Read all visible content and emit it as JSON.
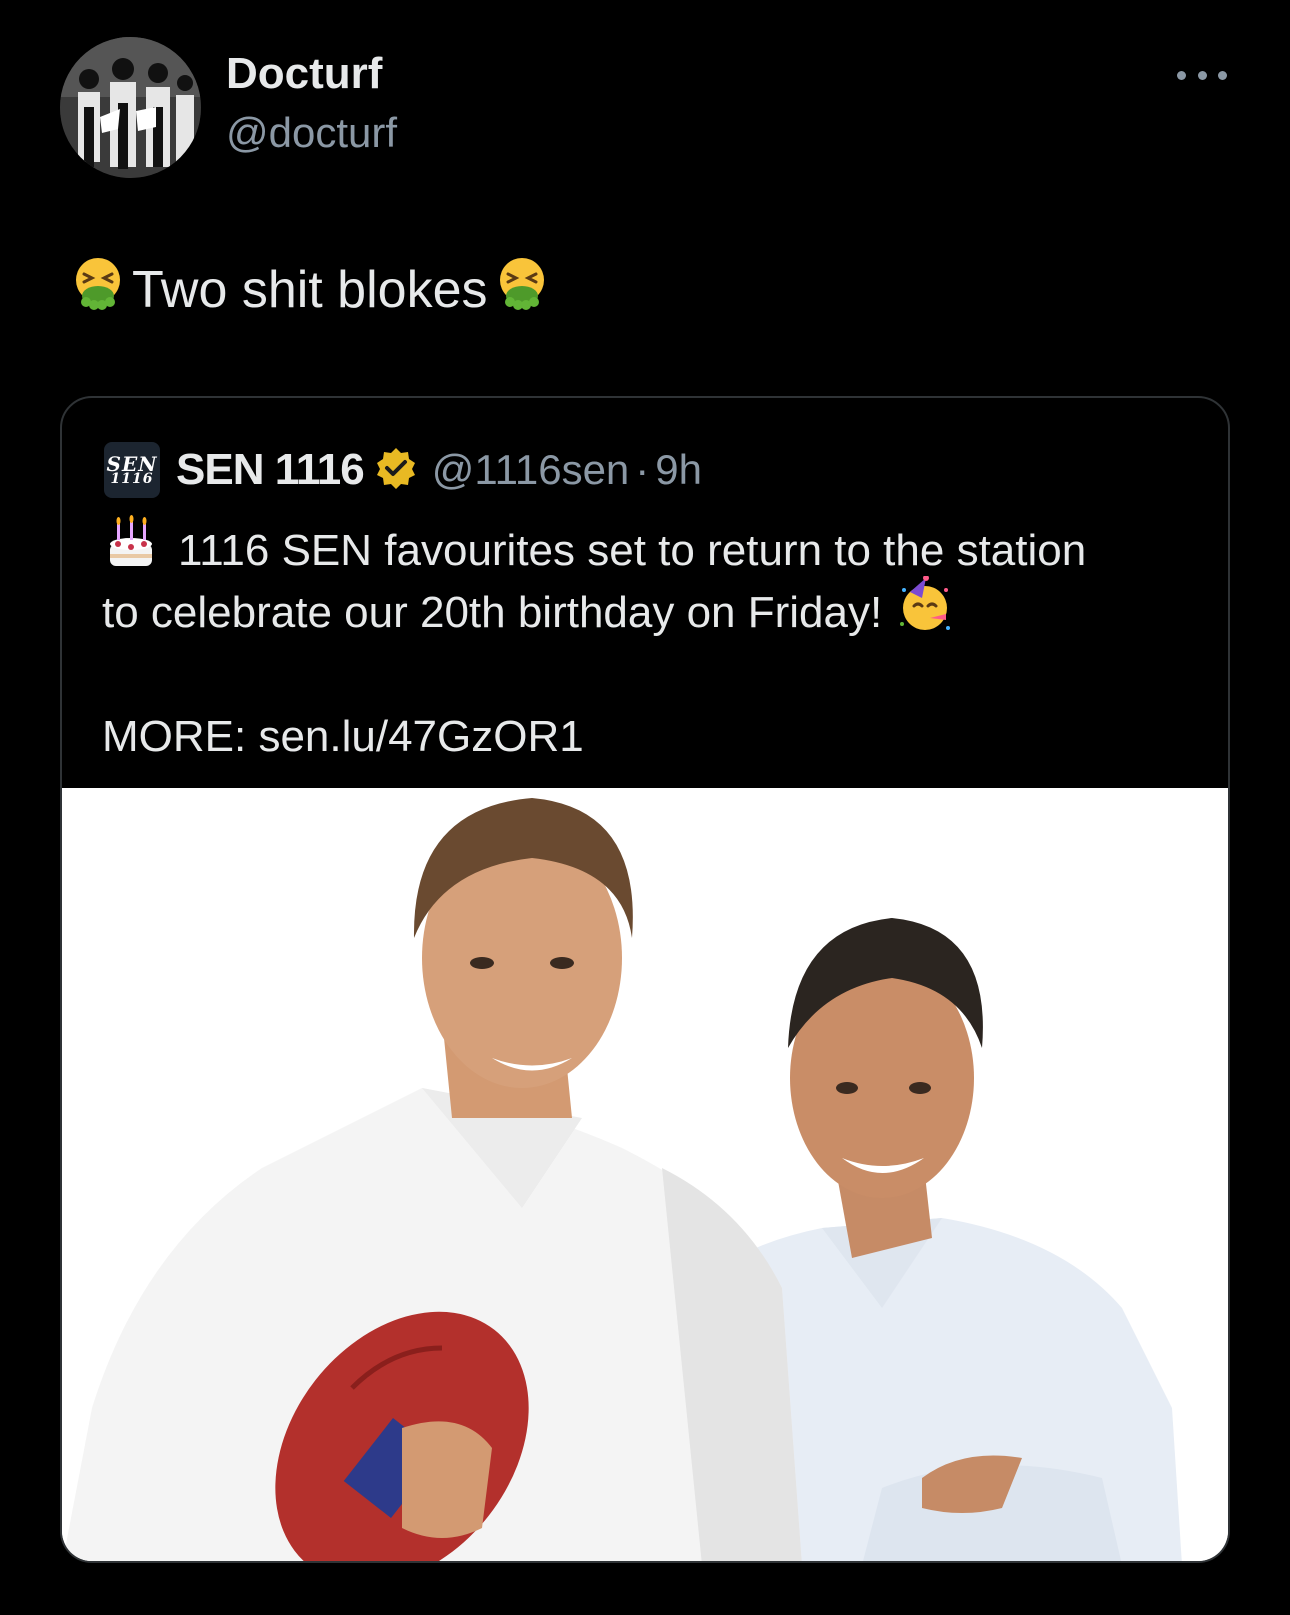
{
  "author": {
    "display_name": "Docturf",
    "handle": "@docturf",
    "avatar_icon": "avatar-photo"
  },
  "tweet": {
    "text": "Two shit blokes",
    "leading_emoji": "vomiting-face-icon",
    "trailing_emoji": "vomiting-face-icon"
  },
  "more_menu": {
    "icon": "more-options-icon"
  },
  "quoted_tweet": {
    "avatar_text_top": "SEN",
    "avatar_text_bottom": "1116",
    "display_name": "SEN 1116",
    "verified_badge": "gold-verified-badge-icon",
    "handle": "@1116sen",
    "separator": "·",
    "time": "9h",
    "line1": "1116 SEN favourites set to return to the station",
    "line2": "to celebrate our 20th birthday on Friday!",
    "line1_emoji": "birthday-cake-icon",
    "line2_emoji": "partying-face-icon",
    "link_line": "MORE: sen.lu/47GzOR1",
    "media_description_icon": "two-men-photo"
  },
  "colors": {
    "background": "#000000",
    "primary_text": "#e7e9ea",
    "secondary_text": "#8b98a5",
    "card_border": "#2f3336",
    "verified_gold": "#e8b923"
  }
}
